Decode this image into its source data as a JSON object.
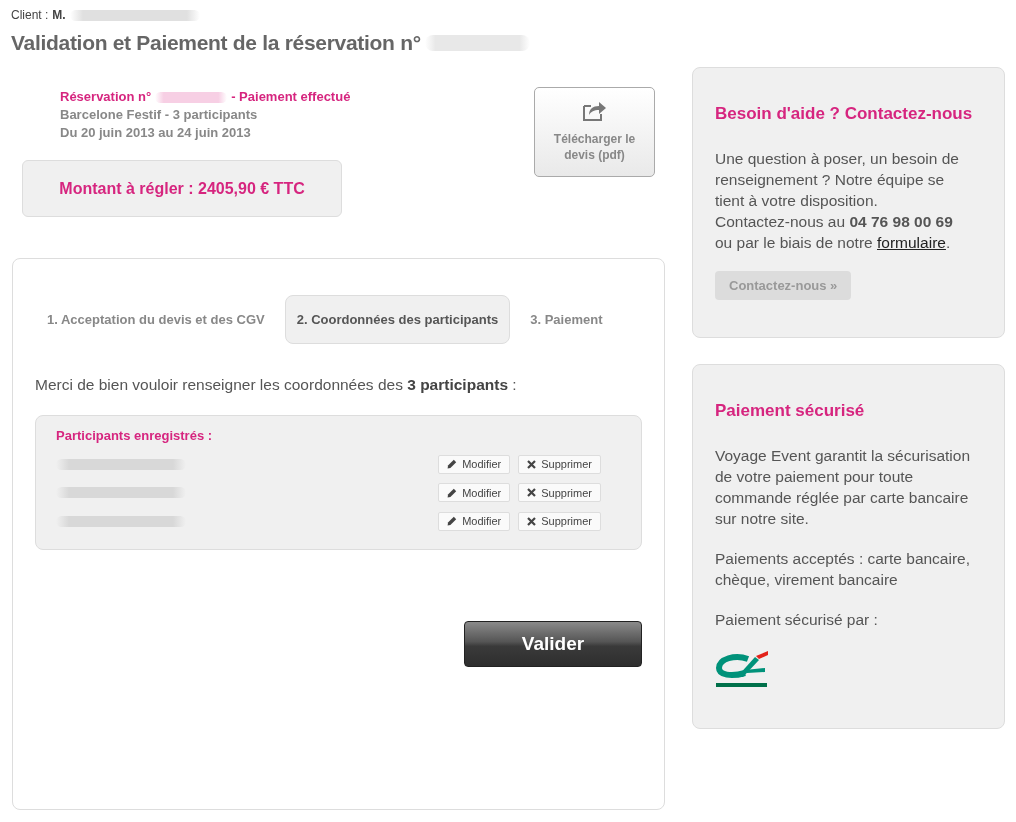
{
  "client": {
    "label": "Client :",
    "name": "M.",
    "name_blurred": true
  },
  "title": {
    "text": "Validation et Paiement de la réservation n°",
    "number_blurred": true
  },
  "reservation": {
    "label": "Réservation n°",
    "number_blurred": true,
    "status": "- Paiement effectué",
    "trip": "Barcelone Festif - 3 participants",
    "dates": "Du 20 juin 2013 au 24 juin 2013"
  },
  "amount": "Montant à régler : 2405,90 € TTC",
  "download_button": "Télécharger le devis (pdf)",
  "tabs": [
    {
      "label": "1. Acceptation du devis et des CGV",
      "selected": false
    },
    {
      "label": "2. Coordonnées des participants",
      "selected": true
    },
    {
      "label": "3. Paiement",
      "selected": false
    }
  ],
  "instruction": "Merci de bien vouloir renseigner les coordonnées des **3 participants** :",
  "participants": {
    "title": "Participants enregistrés :",
    "rows": [
      {
        "name_blurred": true,
        "edit_button": "Modifier",
        "delete_button": "Supprimer"
      },
      {
        "name_blurred": true,
        "edit_button": "Modifier",
        "delete_button": "Supprimer"
      },
      {
        "name_blurred": true,
        "edit_button": "Modifier",
        "delete_button": "Supprimer"
      }
    ]
  },
  "submit_button": "Valider",
  "help": {
    "title": "Besoin d'aide ? Contactez-nous",
    "text": "Une question à poser, un besoin de renseignement ? Notre équipe se tient à votre disposition.",
    "contact": "Contactez-nous au **04 76 98 00 69** ou par le biais de notre",
    "link": "formulaire",
    "after_link": ".",
    "button": "Contactez-nous »"
  },
  "secure": {
    "title": "Paiement sécurisé",
    "paragraphs": [
      "Voyage Event garantit la sécurisation de votre paiement pour toute commande réglée par carte bancaire sur notre site.",
      "Paiements acceptés : carte bancaire, chèque, virement bancaire",
      "Paiement sécurisé par :"
    ]
  }
}
